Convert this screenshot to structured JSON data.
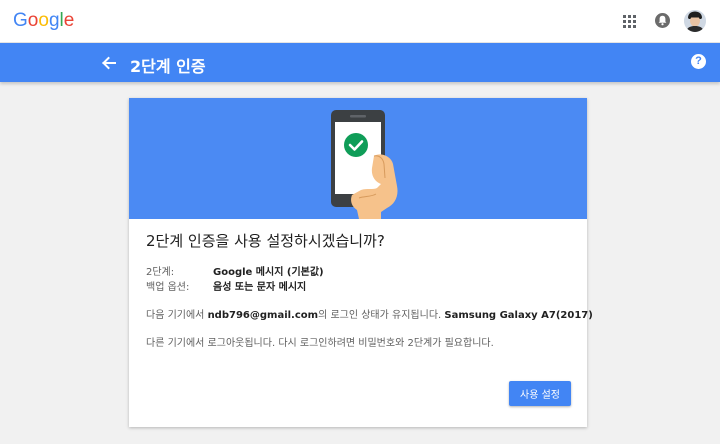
{
  "header": {
    "logo_letters": [
      {
        "char": "G",
        "color": "#4285f4"
      },
      {
        "char": "o",
        "color": "#ea4335"
      },
      {
        "char": "o",
        "color": "#fbbc05"
      },
      {
        "char": "g",
        "color": "#4285f4"
      },
      {
        "char": "l",
        "color": "#34a853"
      },
      {
        "char": "e",
        "color": "#ea4335"
      }
    ],
    "icons": [
      "apps-grid-icon",
      "notifications-icon",
      "account-avatar"
    ]
  },
  "toolbar": {
    "title": "2단계 인증",
    "back_icon": "arrow-back-icon",
    "help_symbol": "?"
  },
  "card": {
    "title": "2단계 인증을 사용 설정하시겠습니까?",
    "info": [
      {
        "label": "2단계:",
        "value": "Google 메시지 (기본값)"
      },
      {
        "label": "백업 옵션:",
        "value": "음성 또는 문자 메시지"
      }
    ],
    "message1": {
      "prefix": "다음 기기에서 ",
      "email": "ndb796@gmail.com",
      "middle": "의 로그인 상태가 유지됩니다. ",
      "device": "Samsung Galaxy A7(2017)"
    },
    "message2": "다른 기기에서 로그아웃됩니다. 다시 로그인하려면 비밀번호와 2단계가 필요합니다.",
    "button_label": "사용 설정"
  },
  "colors": {
    "brand_blue": "#4285f4",
    "hero_blue": "#4b8af3",
    "check_green": "#0f9d58"
  }
}
